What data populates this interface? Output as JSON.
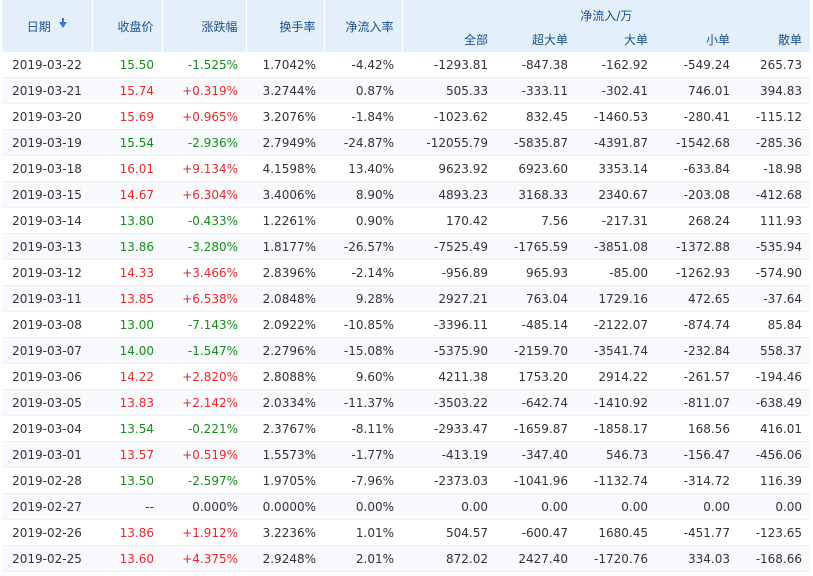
{
  "colors": {
    "up": "#e8282b",
    "down": "#158d18",
    "header_bg": "#e3f0fb",
    "header_text": "#1c4f8c",
    "sort_icon": "#3a7ad5"
  },
  "header": {
    "date": "日期",
    "sort_icon": "arrow-down-icon",
    "close": "收盘价",
    "change": "涨跌幅",
    "turnover": "换手率",
    "net_rate": "净流入率",
    "net_group": "净流入/万",
    "sub": {
      "total": "全部",
      "xl": "超大单",
      "l": "大单",
      "s": "小单",
      "retail": "散单"
    }
  },
  "rows": [
    {
      "date": "2019-03-22",
      "close": "15.50",
      "change": "-1.525%",
      "turnover": "1.7042%",
      "net_rate": "-4.42%",
      "total": "-1293.81",
      "xl": "-847.38",
      "l": "-162.92",
      "s": "-549.24",
      "retail": "265.73",
      "trend": "down"
    },
    {
      "date": "2019-03-21",
      "close": "15.74",
      "change": "+0.319%",
      "turnover": "3.2744%",
      "net_rate": "0.87%",
      "total": "505.33",
      "xl": "-333.11",
      "l": "-302.41",
      "s": "746.01",
      "retail": "394.83",
      "trend": "up"
    },
    {
      "date": "2019-03-20",
      "close": "15.69",
      "change": "+0.965%",
      "turnover": "3.2076%",
      "net_rate": "-1.84%",
      "total": "-1023.62",
      "xl": "832.45",
      "l": "-1460.53",
      "s": "-280.41",
      "retail": "-115.12",
      "trend": "up"
    },
    {
      "date": "2019-03-19",
      "close": "15.54",
      "change": "-2.936%",
      "turnover": "2.7949%",
      "net_rate": "-24.87%",
      "total": "-12055.79",
      "xl": "-5835.87",
      "l": "-4391.87",
      "s": "-1542.68",
      "retail": "-285.36",
      "trend": "down"
    },
    {
      "date": "2019-03-18",
      "close": "16.01",
      "change": "+9.134%",
      "turnover": "4.1598%",
      "net_rate": "13.40%",
      "total": "9623.92",
      "xl": "6923.60",
      "l": "3353.14",
      "s": "-633.84",
      "retail": "-18.98",
      "trend": "up"
    },
    {
      "date": "2019-03-15",
      "close": "14.67",
      "change": "+6.304%",
      "turnover": "3.4006%",
      "net_rate": "8.90%",
      "total": "4893.23",
      "xl": "3168.33",
      "l": "2340.67",
      "s": "-203.08",
      "retail": "-412.68",
      "trend": "up"
    },
    {
      "date": "2019-03-14",
      "close": "13.80",
      "change": "-0.433%",
      "turnover": "1.2261%",
      "net_rate": "0.90%",
      "total": "170.42",
      "xl": "7.56",
      "l": "-217.31",
      "s": "268.24",
      "retail": "111.93",
      "trend": "down"
    },
    {
      "date": "2019-03-13",
      "close": "13.86",
      "change": "-3.280%",
      "turnover": "1.8177%",
      "net_rate": "-26.57%",
      "total": "-7525.49",
      "xl": "-1765.59",
      "l": "-3851.08",
      "s": "-1372.88",
      "retail": "-535.94",
      "trend": "down"
    },
    {
      "date": "2019-03-12",
      "close": "14.33",
      "change": "+3.466%",
      "turnover": "2.8396%",
      "net_rate": "-2.14%",
      "total": "-956.89",
      "xl": "965.93",
      "l": "-85.00",
      "s": "-1262.93",
      "retail": "-574.90",
      "trend": "up"
    },
    {
      "date": "2019-03-11",
      "close": "13.85",
      "change": "+6.538%",
      "turnover": "2.0848%",
      "net_rate": "9.28%",
      "total": "2927.21",
      "xl": "763.04",
      "l": "1729.16",
      "s": "472.65",
      "retail": "-37.64",
      "trend": "up"
    },
    {
      "date": "2019-03-08",
      "close": "13.00",
      "change": "-7.143%",
      "turnover": "2.0922%",
      "net_rate": "-10.85%",
      "total": "-3396.11",
      "xl": "-485.14",
      "l": "-2122.07",
      "s": "-874.74",
      "retail": "85.84",
      "trend": "down"
    },
    {
      "date": "2019-03-07",
      "close": "14.00",
      "change": "-1.547%",
      "turnover": "2.2796%",
      "net_rate": "-15.08%",
      "total": "-5375.90",
      "xl": "-2159.70",
      "l": "-3541.74",
      "s": "-232.84",
      "retail": "558.37",
      "trend": "down"
    },
    {
      "date": "2019-03-06",
      "close": "14.22",
      "change": "+2.820%",
      "turnover": "2.8088%",
      "net_rate": "9.60%",
      "total": "4211.38",
      "xl": "1753.20",
      "l": "2914.22",
      "s": "-261.57",
      "retail": "-194.46",
      "trend": "up"
    },
    {
      "date": "2019-03-05",
      "close": "13.83",
      "change": "+2.142%",
      "turnover": "2.0334%",
      "net_rate": "-11.37%",
      "total": "-3503.22",
      "xl": "-642.74",
      "l": "-1410.92",
      "s": "-811.07",
      "retail": "-638.49",
      "trend": "up"
    },
    {
      "date": "2019-03-04",
      "close": "13.54",
      "change": "-0.221%",
      "turnover": "2.3767%",
      "net_rate": "-8.11%",
      "total": "-2933.47",
      "xl": "-1659.87",
      "l": "-1858.17",
      "s": "168.56",
      "retail": "416.01",
      "trend": "down"
    },
    {
      "date": "2019-03-01",
      "close": "13.57",
      "change": "+0.519%",
      "turnover": "1.5573%",
      "net_rate": "-1.77%",
      "total": "-413.19",
      "xl": "-347.40",
      "l": "546.73",
      "s": "-156.47",
      "retail": "-456.06",
      "trend": "up"
    },
    {
      "date": "2019-02-28",
      "close": "13.50",
      "change": "-2.597%",
      "turnover": "1.9705%",
      "net_rate": "-7.96%",
      "total": "-2373.03",
      "xl": "-1041.96",
      "l": "-1132.74",
      "s": "-314.72",
      "retail": "116.39",
      "trend": "down"
    },
    {
      "date": "2019-02-27",
      "close": "--",
      "change": "0.000%",
      "turnover": "0.0000%",
      "net_rate": "0.00%",
      "total": "0.00",
      "xl": "0.00",
      "l": "0.00",
      "s": "0.00",
      "retail": "0.00",
      "trend": "flat"
    },
    {
      "date": "2019-02-26",
      "close": "13.86",
      "change": "+1.912%",
      "turnover": "3.2236%",
      "net_rate": "1.01%",
      "total": "504.57",
      "xl": "-600.47",
      "l": "1680.45",
      "s": "-451.77",
      "retail": "-123.65",
      "trend": "up"
    },
    {
      "date": "2019-02-25",
      "close": "13.60",
      "change": "+4.375%",
      "turnover": "2.9248%",
      "net_rate": "2.01%",
      "total": "872.02",
      "xl": "2427.40",
      "l": "-1720.76",
      "s": "334.03",
      "retail": "-168.66",
      "trend": "up"
    }
  ]
}
